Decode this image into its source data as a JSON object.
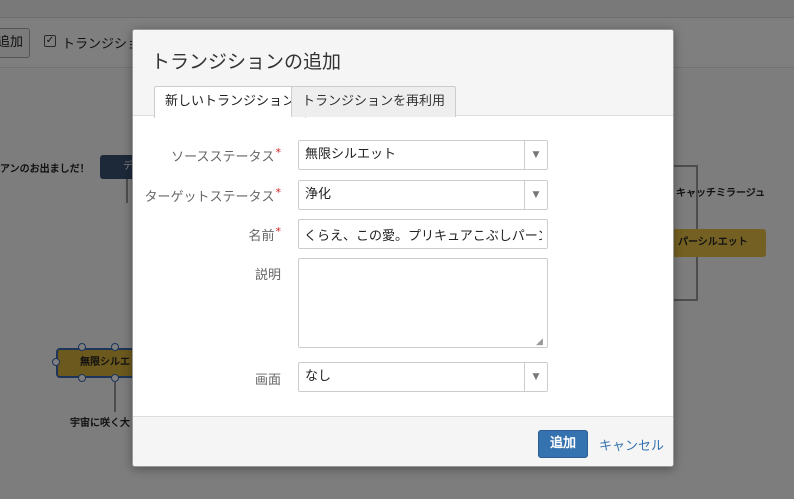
{
  "background": {
    "toolbar": {
      "add_button_label": "追加",
      "checkbox_label": "トランジション",
      "checkbox_mark": "✓"
    },
    "canvas": {
      "text_left": "アンのお出ましだ！",
      "dark_status_label": "デ",
      "text_right": "キャッチミラージュ",
      "yellow_status_right": "パーシルエット",
      "yellow_status_left": "無限シルエ",
      "text_bottom": "宇宙に咲く大"
    }
  },
  "dialog": {
    "title": "トランジションの追加",
    "tabs": [
      {
        "label": "新しいトランジション",
        "active": true
      },
      {
        "label": "トランジションを再利用",
        "active": false
      }
    ],
    "required_mark": "*",
    "fields": {
      "source_status": {
        "label": "ソースステータス",
        "value": "無限シルエット"
      },
      "target_status": {
        "label": "ターゲットステータス",
        "value": "浄化"
      },
      "name": {
        "label": "名前",
        "value": "くらえ、この愛。プリキュアこぶしパーンチ"
      },
      "description": {
        "label": "説明",
        "value": ""
      },
      "screen": {
        "label": "画面",
        "value": "なし"
      }
    },
    "dropdown_arrow": "▼",
    "footer": {
      "submit_label": "追加",
      "cancel_label": "キャンセル"
    }
  }
}
